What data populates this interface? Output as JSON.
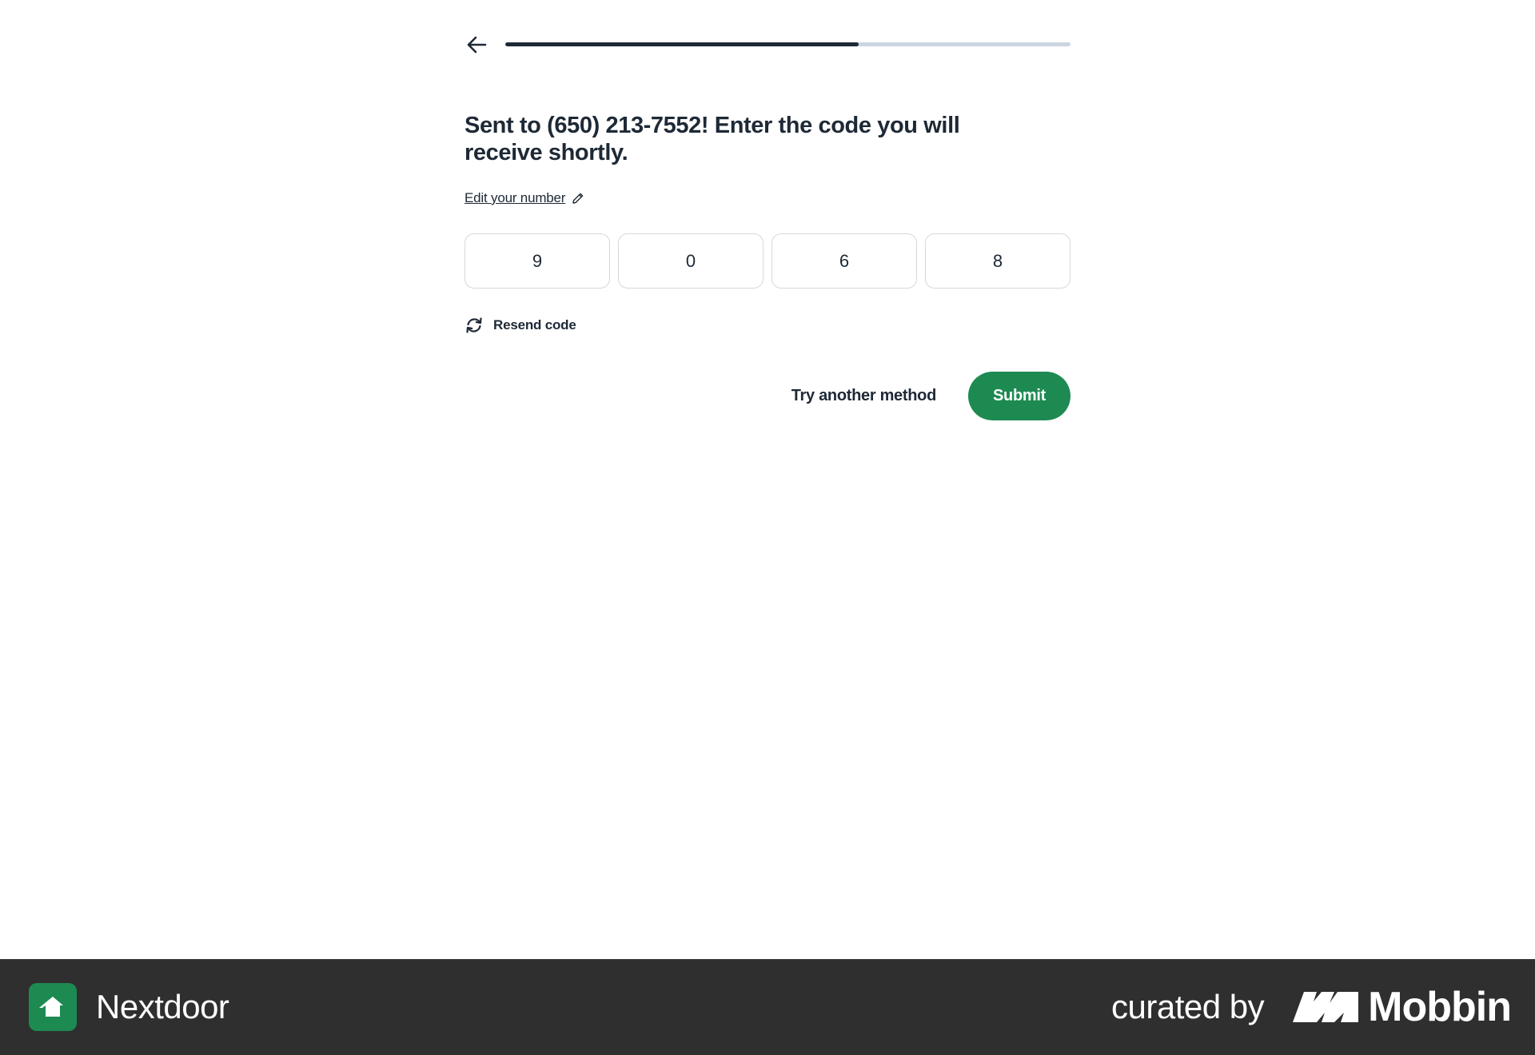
{
  "colors": {
    "text_primary": "#1e2936",
    "progress_fill": "#1e2936",
    "progress_track": "#cbd5e1",
    "brand_green": "#1d8a52",
    "footer_bg": "#2f2f2f"
  },
  "header": {
    "back_icon": "arrow-left-icon",
    "progress_fraction": 0.625
  },
  "main": {
    "headline": "Sent to (650) 213-7552! Enter the code you will receive shortly.",
    "edit_number_label": "Edit your number",
    "edit_icon": "pencil-icon",
    "code_digits": [
      "9",
      "0",
      "6",
      "8"
    ],
    "resend_icon": "refresh-icon",
    "resend_label": "Resend code",
    "try_another_label": "Try another method",
    "submit_label": "Submit"
  },
  "footer": {
    "app_icon": "nextdoor-house-icon",
    "app_name": "Nextdoor",
    "curated_by": "curated by",
    "mobbin_icon": "mobbin-logo-icon",
    "mobbin_name": "Mobbin"
  }
}
